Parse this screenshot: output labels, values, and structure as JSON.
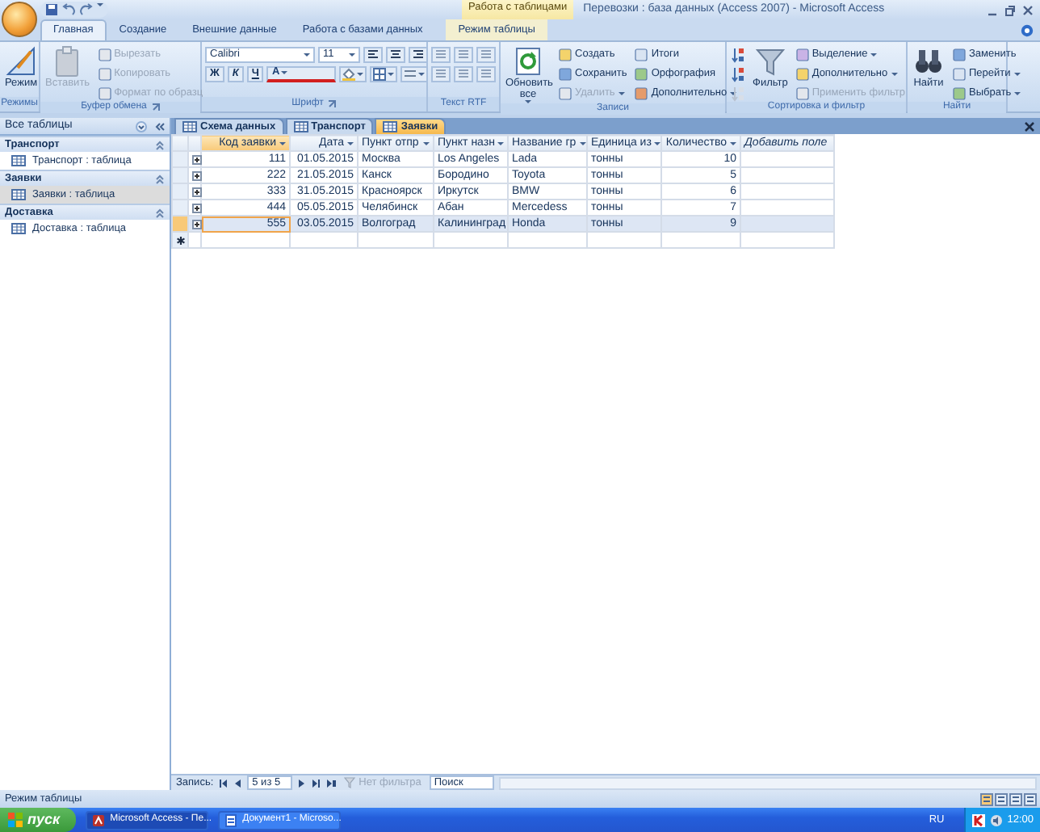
{
  "title_bar": {
    "context_label": "Работа с таблицами",
    "title": "Перевозки : база данных (Access 2007) - Microsoft Access"
  },
  "ribbon_tabs": [
    {
      "label": "Главная",
      "selected": true,
      "kind": "standard"
    },
    {
      "label": "Создание",
      "selected": false,
      "kind": "standard"
    },
    {
      "label": "Внешние данные",
      "selected": false,
      "kind": "standard"
    },
    {
      "label": "Работа с базами данных",
      "selected": false,
      "kind": "standard"
    },
    {
      "label": "Режим таблицы",
      "selected": false,
      "kind": "contextual"
    }
  ],
  "ribbon_groups": [
    {
      "label": "Режимы",
      "kind": "commands",
      "launcher": false,
      "commands": [
        {
          "kind": "large",
          "label": "Режим",
          "disabled": false,
          "dropdown": false
        }
      ]
    },
    {
      "label": "Буфер обмена",
      "kind": "commands",
      "launcher": true,
      "commands": [
        {
          "kind": "large",
          "label": "Вставить",
          "disabled": true,
          "dropdown": false
        },
        {
          "kind": "small",
          "label": "Вырезать",
          "disabled": true,
          "dropdown": false
        },
        {
          "kind": "small",
          "label": "Копировать",
          "disabled": true,
          "dropdown": false
        },
        {
          "kind": "small",
          "label": "Формат по образц",
          "disabled": true,
          "dropdown": false
        }
      ]
    },
    {
      "label": "Шрифт",
      "kind": "font",
      "launcher": true,
      "font": "Calibri",
      "size": "11",
      "format_buttons": [
        "Ж",
        "К",
        "Ч",
        "А"
      ]
    },
    {
      "label": "Текст RTF",
      "kind": "icons",
      "launcher": false
    },
    {
      "label": "Записи",
      "kind": "commands",
      "launcher": false,
      "commands": [
        {
          "kind": "large",
          "label": "Обновить все",
          "disabled": false,
          "dropdown": true
        },
        {
          "kind": "small",
          "label": "Создать",
          "disabled": false,
          "dropdown": false
        },
        {
          "kind": "small",
          "label": "Сохранить",
          "disabled": false,
          "dropdown": false
        },
        {
          "kind": "small",
          "label": "Удалить",
          "disabled": true,
          "dropdown": true
        },
        {
          "kind": "small",
          "label": "Итоги",
          "disabled": false,
          "dropdown": false
        },
        {
          "kind": "small",
          "label": "Орфография",
          "disabled": false,
          "dropdown": false
        },
        {
          "kind": "small",
          "label": "Дополнительно",
          "disabled": false,
          "dropdown": true
        }
      ]
    },
    {
      "label": "Сортировка и фильтр",
      "kind": "commands",
      "launcher": false,
      "commands": [
        {
          "kind": "icon",
          "disabled": false
        },
        {
          "kind": "icon",
          "disabled": false
        },
        {
          "kind": "icon",
          "disabled": true
        },
        {
          "kind": "large",
          "label": "Фильтр",
          "disabled": false,
          "dropdown": false
        },
        {
          "kind": "small",
          "label": "Выделение",
          "disabled": false,
          "dropdown": true
        },
        {
          "kind": "small",
          "label": "Дополнительно",
          "disabled": false,
          "dropdown": true
        },
        {
          "kind": "small",
          "label": "Применить фильтр",
          "disabled": true,
          "dropdown": false
        }
      ]
    },
    {
      "label": "Найти",
      "kind": "commands",
      "launcher": false,
      "commands": [
        {
          "kind": "large",
          "label": "Найти",
          "disabled": false,
          "dropdown": false
        },
        {
          "kind": "small",
          "label": "Заменить",
          "disabled": false,
          "dropdown": false
        },
        {
          "kind": "small",
          "label": "Перейти",
          "disabled": false,
          "dropdown": true
        },
        {
          "kind": "small",
          "label": "Выбрать",
          "disabled": false,
          "dropdown": true
        }
      ]
    }
  ],
  "nav_pane": {
    "title": "Все таблицы",
    "groups": [
      {
        "label": "Транспорт",
        "items": [
          {
            "label": "Транспорт : таблица",
            "selected": false
          }
        ]
      },
      {
        "label": "Заявки",
        "items": [
          {
            "label": "Заявки : таблица",
            "selected": true
          }
        ]
      },
      {
        "label": "Доставка",
        "items": [
          {
            "label": "Доставка : таблица",
            "selected": false
          }
        ]
      }
    ]
  },
  "document_tabs": [
    {
      "label": "Схема данных",
      "selected": false
    },
    {
      "label": "Транспорт",
      "selected": false
    },
    {
      "label": "Заявки",
      "selected": true
    }
  ],
  "datasheet": {
    "columns": [
      {
        "label": "Код заявки",
        "kind": "number",
        "selected": true
      },
      {
        "label": "Дата",
        "kind": "number",
        "selected": false
      },
      {
        "label": "Пункт отпр",
        "kind": "text",
        "selected": false
      },
      {
        "label": "Пункт назн",
        "kind": "text",
        "selected": false
      },
      {
        "label": "Название гр",
        "kind": "text",
        "selected": false
      },
      {
        "label": "Единица из",
        "kind": "text",
        "selected": false
      },
      {
        "label": "Количество",
        "kind": "number",
        "selected": false
      },
      {
        "label": "Добавить поле",
        "kind": "add",
        "selected": false
      }
    ],
    "rows": [
      {
        "selected": false,
        "cells": [
          "111",
          "01.05.2015",
          "Москва",
          "Los Angeles",
          "Lada",
          "тонны",
          "10"
        ]
      },
      {
        "selected": false,
        "cells": [
          "222",
          "21.05.2015",
          "Канск",
          "Бородино",
          "Toyota",
          "тонны",
          "5"
        ]
      },
      {
        "selected": false,
        "cells": [
          "333",
          "31.05.2015",
          "Красноярск",
          "Иркутск",
          "BMW",
          "тонны",
          "6"
        ]
      },
      {
        "selected": false,
        "cells": [
          "444",
          "05.05.2015",
          "Челябинск",
          "Абан",
          "Mercedess",
          "тонны",
          "7"
        ]
      },
      {
        "selected": true,
        "cells": [
          "555",
          "03.05.2015",
          "Волгоград",
          "Калининград",
          "Honda",
          "тонны",
          "9"
        ]
      }
    ]
  },
  "record_nav": {
    "label": "Запись:",
    "position": "5 из 5",
    "filter": "Нет фильтра",
    "search_placeholder": "Поиск"
  },
  "status_bar": {
    "text": "Режим таблицы"
  },
  "taskbar": {
    "start": "пуск",
    "tasks": [
      {
        "label": "Microsoft Access - Пе...",
        "selected": true
      },
      {
        "label": "Документ1 - Microso...",
        "selected": false
      }
    ],
    "language": "RU",
    "clock": "12:00"
  }
}
